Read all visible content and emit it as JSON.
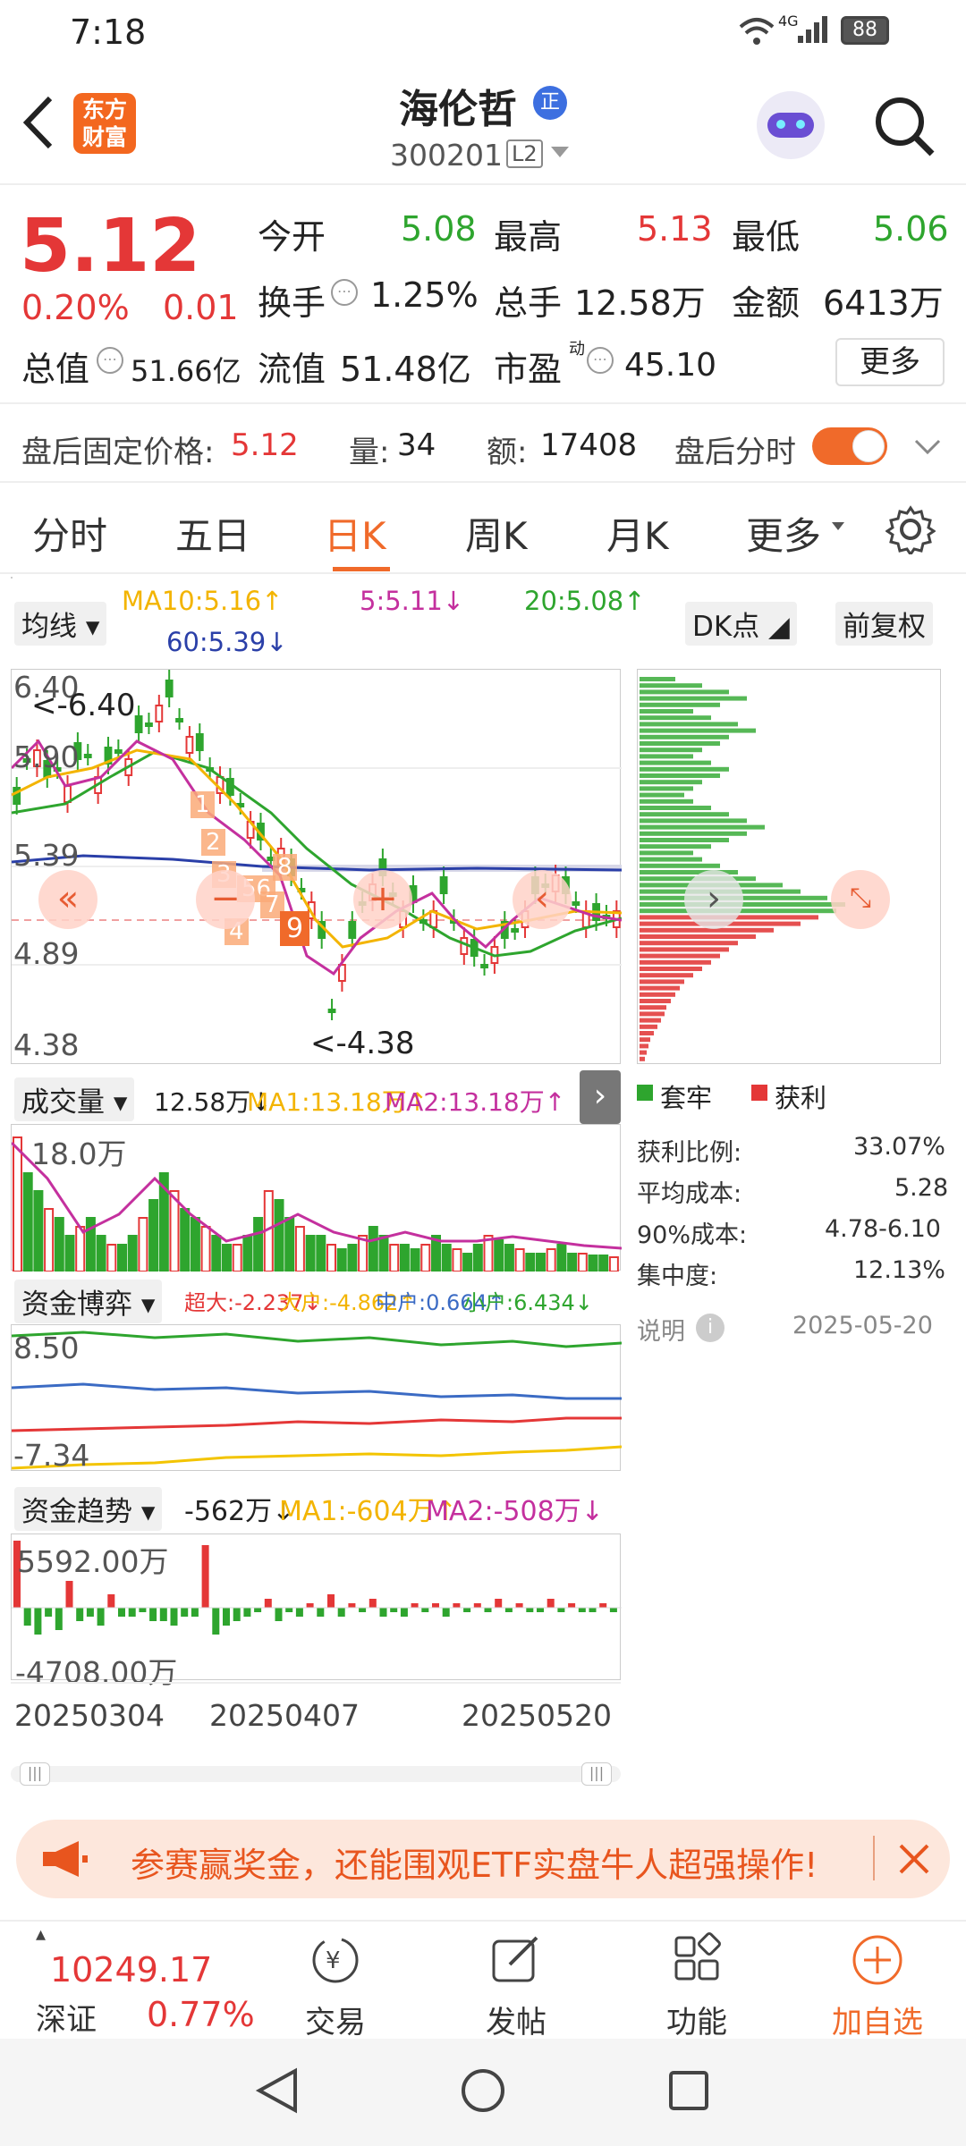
{
  "status_bar": {
    "time": "7:18",
    "network": "4G",
    "battery": "88"
  },
  "header": {
    "logo_text_1": "东方",
    "logo_text_2": "财富",
    "stock_name": "海伦哲",
    "name_badge": "正",
    "stock_code": "300201",
    "level": "L2"
  },
  "quote": {
    "price": "5.12",
    "change_pct": "0.20%",
    "change_amt": "0.01",
    "open_label": "今开",
    "open": "5.08",
    "high_label": "最高",
    "high": "5.13",
    "low_label": "最低",
    "low": "5.06",
    "turnover_label": "换手",
    "turnover": "1.25%",
    "volume_label": "总手",
    "volume": "12.58万",
    "amount_label": "金额",
    "amount": "6413万",
    "mktcap_label": "总值",
    "mktcap": "51.66亿",
    "float_label": "流值",
    "float": "51.48亿",
    "pe_label": "市盈",
    "pe_sup": "动",
    "pe": "45.10",
    "more_button": "更多",
    "after_price_label": "盘后固定价格:",
    "after_price": "5.12",
    "after_vol_label": "量:",
    "after_vol": "34",
    "after_amt_label": "额:",
    "after_amt": "17408",
    "after_toggle_label": "盘后分时",
    "after_toggle_on": true
  },
  "tabs": [
    {
      "label": "分时"
    },
    {
      "label": "五日"
    },
    {
      "label": "日K",
      "active": true
    },
    {
      "label": "周K"
    },
    {
      "label": "月K"
    },
    {
      "label": "更多"
    }
  ],
  "kline": {
    "ma_select": "均线",
    "ma10": "MA10:5.16↑",
    "ma5": "5:5.11↓",
    "ma20": "20:5.08↑",
    "ma60": "60:5.39↓",
    "dk_select": "DK点",
    "adjust": "前复权",
    "y_labels": [
      "6.40",
      "5.90",
      "5.39",
      "4.89",
      "4.38"
    ],
    "max_label": "<-6.40",
    "min_label": "<-4.38",
    "signal_markers": [
      "1",
      "2",
      "3",
      "4",
      "56",
      "7",
      "8",
      "9"
    ],
    "chip_legend_trapped": "套牢",
    "chip_legend_profit": "获利"
  },
  "chip_info": {
    "profit_ratio_label": "获利比例:",
    "profit_ratio": "33.07%",
    "avg_cost_label": "平均成本:",
    "avg_cost": "5.28",
    "cost90_label": "90%成本:",
    "cost90": "4.78-6.10",
    "concentration_label": "集中度:",
    "concentration": "12.13%",
    "explain_label": "说明",
    "date": "2025-05-20"
  },
  "volume_panel": {
    "select": "成交量",
    "value": "12.58万↓",
    "ma1": "MA1:13.18万↑",
    "ma2": "MA2:13.18万↑",
    "top_label": "18.0万"
  },
  "capital_game": {
    "select": "资金博弈",
    "super": "超大:-2.237↓",
    "big": "大户:-4.862↑",
    "mid": "中户:0.664↑",
    "small": "小户:6.434↓",
    "top_label": "8.50",
    "bottom_label": "-7.34"
  },
  "capital_trend": {
    "select": "资金趋势",
    "value": "-562万↓",
    "ma1": "MA1:-604万↑",
    "ma2": "MA2:-508万↓",
    "top_label": "5592.00万",
    "bottom_label": "-4708.00万"
  },
  "dates": [
    "20250304",
    "20250407",
    "20250520"
  ],
  "banner": {
    "text": "参赛赢奖金，还能围观ETF实盘牛人超强操作!"
  },
  "bottom_nav": {
    "index_value": "10249.17",
    "index_name": "深证",
    "index_change": "0.77%",
    "trade": "交易",
    "post": "发帖",
    "function": "功能",
    "add_watch": "加自选"
  },
  "colors": {
    "red": "#e43737",
    "green": "#2ea52e",
    "accent": "#f06a2a"
  }
}
